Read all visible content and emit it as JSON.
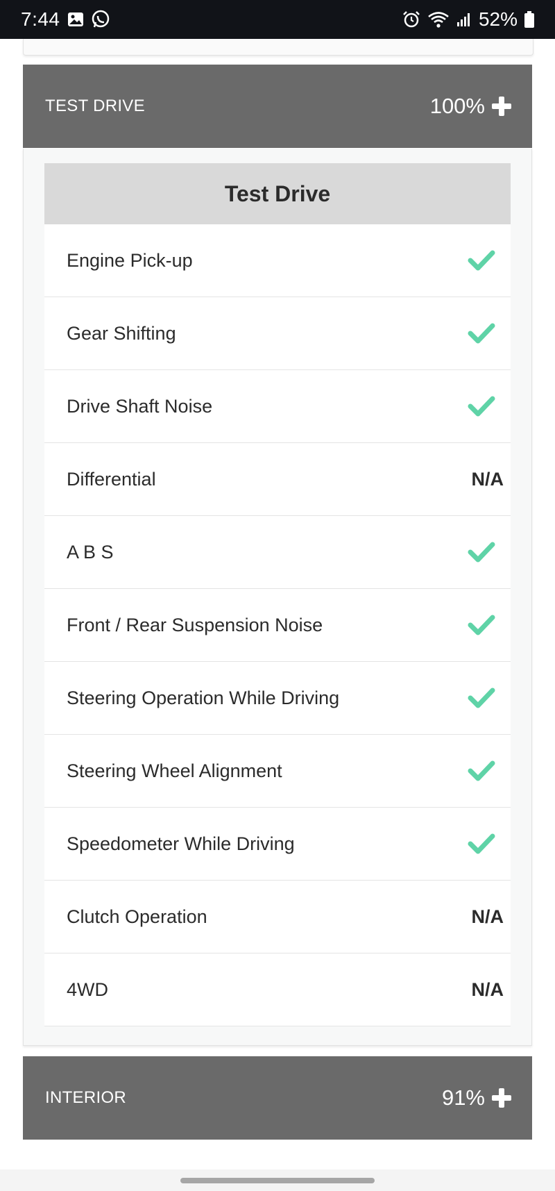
{
  "status_bar": {
    "time": "7:44",
    "battery": "52%",
    "icons_left": [
      "image-icon",
      "whatsapp-icon"
    ],
    "icons_right": [
      "alarm-icon",
      "wifi-icon",
      "signal-icon",
      "battery-icon"
    ]
  },
  "sections": [
    {
      "title": "TEST DRIVE",
      "score": "100%",
      "expanded": true,
      "table_title": "Test Drive",
      "rows": [
        {
          "label": "Engine Pick-up",
          "value": "check"
        },
        {
          "label": "Gear Shifting",
          "value": "check"
        },
        {
          "label": "Drive Shaft Noise",
          "value": "check"
        },
        {
          "label": "Differential",
          "value": "N/A"
        },
        {
          "label": "A B S",
          "value": "check"
        },
        {
          "label": "Front / Rear Suspension Noise",
          "value": "check"
        },
        {
          "label": "Steering Operation While Driving",
          "value": "check"
        },
        {
          "label": "Steering Wheel Alignment",
          "value": "check"
        },
        {
          "label": "Speedometer While Driving",
          "value": "check"
        },
        {
          "label": "Clutch Operation",
          "value": "N/A"
        },
        {
          "label": "4WD",
          "value": "N/A"
        }
      ]
    },
    {
      "title": "INTERIOR",
      "score": "91%",
      "expanded": false
    }
  ],
  "colors": {
    "status_bar_bg": "#111318",
    "header_bg": "#6a6a6a",
    "table_head_bg": "#d9d9d9",
    "check_color": "#5fd3a7"
  }
}
